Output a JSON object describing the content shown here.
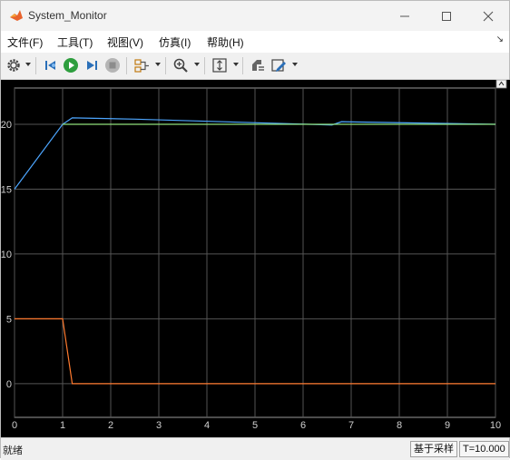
{
  "window": {
    "title": "System_Monitor",
    "icon": "matlab-logo-icon"
  },
  "menu": {
    "items": [
      "文件(F)",
      "工具(T)",
      "视图(V)",
      "仿真(I)",
      "帮助(H)"
    ]
  },
  "toolbar": {
    "buttons": [
      "settings-gear-icon",
      "step-back-icon",
      "run-icon",
      "step-forward-icon",
      "stop-icon",
      "signal-select-icon",
      "zoom-icon",
      "autoscale-icon",
      "highlight-block-icon",
      "edit-style-icon"
    ]
  },
  "status": {
    "left": "就绪",
    "mode": "基于采样",
    "time": "T=10.000"
  },
  "colors": {
    "series_blue": "#4da6ff",
    "series_green": "#8fe07a",
    "series_orange": "#ff7a2e",
    "grid": "#555555",
    "background": "#000000"
  },
  "chart_data": {
    "type": "line",
    "title": "",
    "xlabel": "",
    "ylabel": "",
    "xlim": [
      0,
      10
    ],
    "ylim": [
      -2.6,
      22.8
    ],
    "xticks": [
      0,
      1,
      2,
      3,
      4,
      5,
      6,
      7,
      8,
      9,
      10
    ],
    "yticks": [
      0,
      5,
      10,
      15,
      20
    ],
    "grid": true,
    "series": [
      {
        "color": "#4da6ff",
        "x": [
          0,
          1,
          1.2,
          2.5,
          6.6,
          6.8,
          10
        ],
        "y": [
          15,
          20,
          20.5,
          20.4,
          19.95,
          20.2,
          20
        ]
      },
      {
        "color": "#8fe07a",
        "x": [
          1,
          2,
          4,
          6,
          7,
          10
        ],
        "y": [
          20,
          20,
          20,
          20,
          20,
          20
        ]
      },
      {
        "color": "#ff7a2e",
        "x": [
          0,
          1,
          1.2,
          10
        ],
        "y": [
          5,
          5,
          0,
          0
        ]
      }
    ]
  }
}
